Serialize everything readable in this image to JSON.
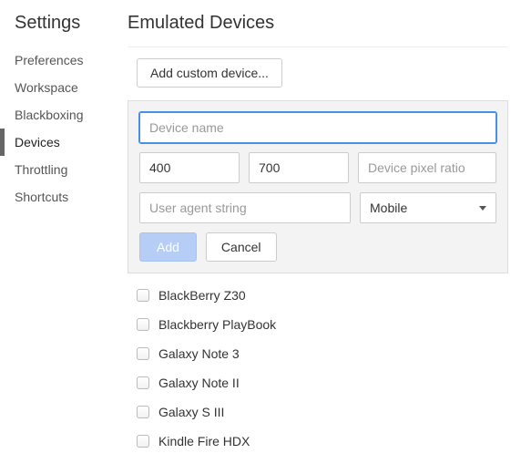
{
  "sidebar": {
    "title": "Settings",
    "items": [
      {
        "label": "Preferences",
        "active": false
      },
      {
        "label": "Workspace",
        "active": false
      },
      {
        "label": "Blackboxing",
        "active": false
      },
      {
        "label": "Devices",
        "active": true
      },
      {
        "label": "Throttling",
        "active": false
      },
      {
        "label": "Shortcuts",
        "active": false
      }
    ]
  },
  "main": {
    "title": "Emulated Devices",
    "add_custom_label": "Add custom device...",
    "form": {
      "name_placeholder": "Device name",
      "name_value": "",
      "width_value": "400",
      "height_value": "700",
      "pixel_ratio_placeholder": "Device pixel ratio",
      "pixel_ratio_value": "",
      "user_agent_placeholder": "User agent string",
      "user_agent_value": "",
      "type_selected": "Mobile",
      "add_label": "Add",
      "cancel_label": "Cancel"
    },
    "devices": [
      {
        "label": "BlackBerry Z30",
        "checked": false
      },
      {
        "label": "Blackberry PlayBook",
        "checked": false
      },
      {
        "label": "Galaxy Note 3",
        "checked": false
      },
      {
        "label": "Galaxy Note II",
        "checked": false
      },
      {
        "label": "Galaxy S III",
        "checked": false
      },
      {
        "label": "Kindle Fire HDX",
        "checked": false
      }
    ]
  }
}
